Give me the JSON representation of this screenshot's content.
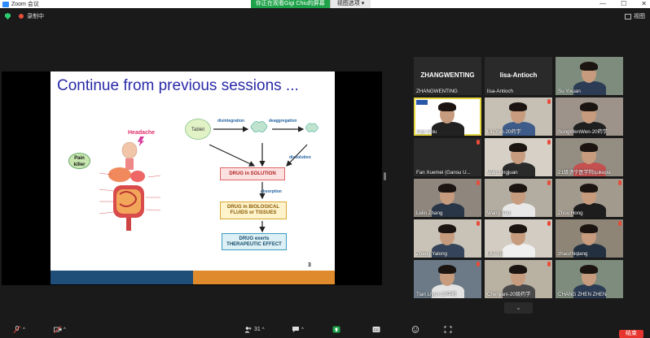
{
  "window": {
    "app_title": "Zoom 会议",
    "controls": [
      "—",
      "☐",
      "✕"
    ]
  },
  "share_banner": {
    "viewing_text": "你正在观看Gigi Chiu的屏幕",
    "view_options": "视图选项 ▾"
  },
  "top": {
    "recording_label": "录制中",
    "view_label": "视图"
  },
  "slide": {
    "title": "Continue from previous sessions ...",
    "page_number": "3",
    "pain_killer": "Pain killer",
    "headache": "Headache",
    "tablet": "Tablet",
    "disintegration": "disintegration",
    "deaggregation": "deaggregation",
    "dissolution": "dissolution",
    "absorption": "absorption",
    "drug_solution": "DRUG in SOLUTION",
    "drug_bio": "DRUG in BIOLOGICAL FLUIDS or TISSUES",
    "drug_effect": "DRUG exerts THERAPEUTIC EFFECT"
  },
  "gallery": {
    "participants": [
      {
        "name": "ZHANGWENTING",
        "big": "ZHANGWENTING",
        "video": false,
        "muted": false
      },
      {
        "name": "lisa-Antioch",
        "big": "lisa-Antioch",
        "video": false,
        "muted": false
      },
      {
        "name": "Su Yixuan",
        "video": true,
        "muted": false
      },
      {
        "name": "Gigi Chiu",
        "video": true,
        "active": true,
        "muted": false
      },
      {
        "name": "Liu Yan-20药学",
        "video": true,
        "muted": true
      },
      {
        "name": "SongWenWen-20药学",
        "video": true,
        "muted": false
      },
      {
        "name": "Fan Xuemei (Gansu U...",
        "video": false,
        "muted": true
      },
      {
        "name": "Wan Lingjuan",
        "video": true,
        "muted": true
      },
      {
        "name": "21级济宁医学院qukepu",
        "video": true,
        "muted": false
      },
      {
        "name": "Lelin Zhang",
        "video": true,
        "muted": true
      },
      {
        "name": "Wang Xiao",
        "video": true,
        "muted": true
      },
      {
        "name": "Zhou Hong",
        "video": true,
        "muted": true
      },
      {
        "name": "Zhang Yalong",
        "video": true,
        "muted": true
      },
      {
        "name": "LIU YU",
        "video": true,
        "muted": true
      },
      {
        "name": "zhaozhiqiang",
        "video": true,
        "muted": true
      },
      {
        "name": "Tian Liyun-20中药",
        "video": true,
        "muted": true
      },
      {
        "name": "Chenjiani-20级药学",
        "video": true,
        "muted": true
      },
      {
        "name": "CHANG ZHEN ZHEN",
        "video": true,
        "muted": false
      }
    ],
    "page_down": "⌄"
  },
  "toolbar": {
    "participants_count": "31",
    "end_label": "结束"
  },
  "colors": {
    "accent_green": "#1fa34a",
    "end_red": "#e5352e",
    "active_speaker": "#e6d640",
    "slide_title": "#2a2aa8"
  }
}
